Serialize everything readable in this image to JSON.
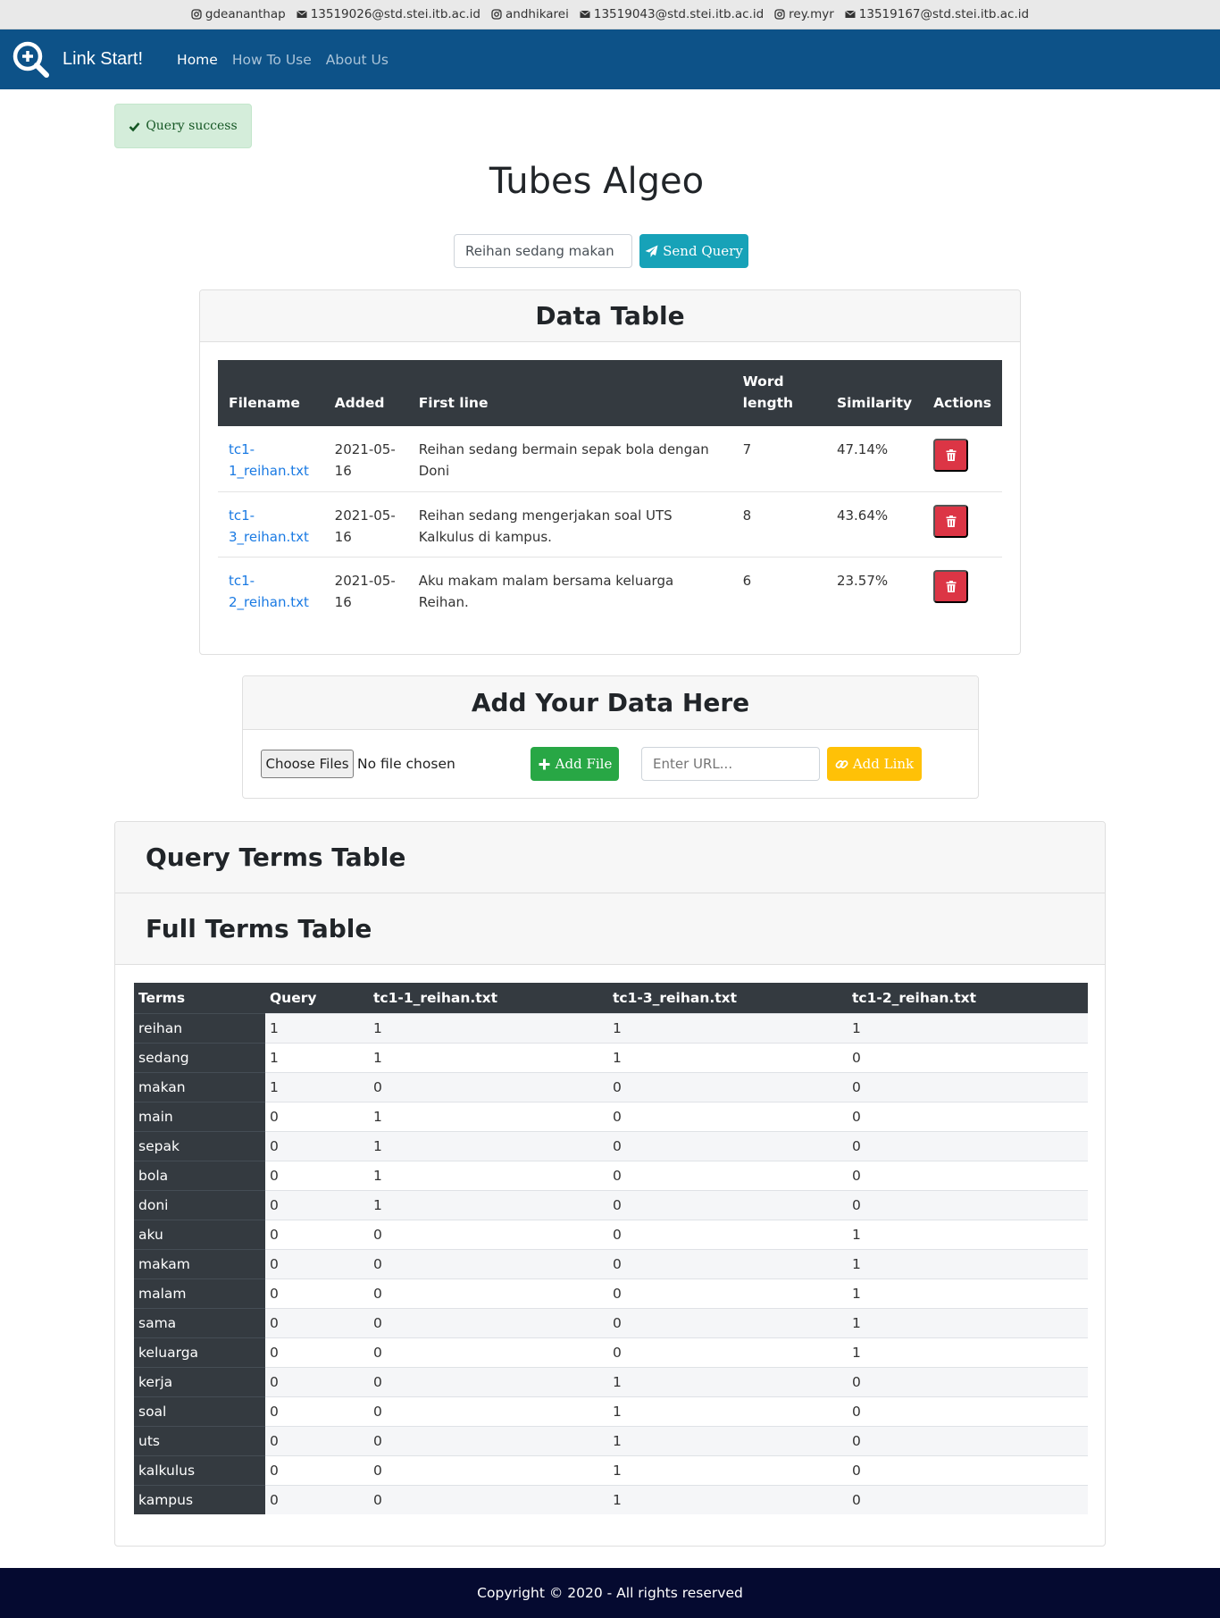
{
  "topbar": {
    "contacts": [
      {
        "icon": "instagram-icon",
        "text": "gdeananthap"
      },
      {
        "icon": "envelope-icon",
        "text": "13519026@std.stei.itb.ac.id"
      },
      {
        "icon": "instagram-icon",
        "text": "andhikarei"
      },
      {
        "icon": "envelope-icon",
        "text": "13519043@std.stei.itb.ac.id"
      },
      {
        "icon": "instagram-icon",
        "text": "rey.myr"
      },
      {
        "icon": "envelope-icon",
        "text": "13519167@std.stei.itb.ac.id"
      }
    ]
  },
  "navbar": {
    "brand": "Link Start!",
    "links": [
      "Home",
      "How To Use",
      "About Us"
    ],
    "active": "Home",
    "color": "#0d5288"
  },
  "alert": {
    "text": "Query success",
    "icon": "check-icon"
  },
  "title": "Tubes Algeo",
  "query": {
    "value": "Reihan sedang makan",
    "button": "Send Query",
    "icon": "paper-plane-icon"
  },
  "data_table": {
    "title": "Data Table",
    "headers": [
      "Filename",
      "Added",
      "First line",
      "Word length",
      "Similarity",
      "Actions"
    ],
    "rows": [
      {
        "filename": "tc1-1_reihan.txt",
        "added": "2021-05-16",
        "first_line": "Reihan sedang bermain sepak bola dengan Doni",
        "word_length": "7",
        "similarity": "47.14%"
      },
      {
        "filename": "tc1-3_reihan.txt",
        "added": "2021-05-16",
        "first_line": "Reihan sedang mengerjakan soal UTS Kalkulus di kampus.",
        "word_length": "8",
        "similarity": "43.64%"
      },
      {
        "filename": "tc1-2_reihan.txt",
        "added": "2021-05-16",
        "first_line": "Aku makam malam bersama keluarga Reihan.",
        "word_length": "6",
        "similarity": "23.57%"
      }
    ]
  },
  "add_data": {
    "title": "Add Your Data Here",
    "choose_files": "Choose Files",
    "no_file": "No file chosen",
    "add_file": "Add File",
    "url_placeholder": "Enter URL...",
    "add_link": "Add Link"
  },
  "query_terms_title": "Query Terms Table",
  "full_terms": {
    "title": "Full Terms Table",
    "headers": [
      "Terms",
      "Query",
      "tc1-1_reihan.txt",
      "tc1-3_reihan.txt",
      "tc1-2_reihan.txt"
    ],
    "rows": [
      [
        "reihan",
        "1",
        "1",
        "1",
        "1"
      ],
      [
        "sedang",
        "1",
        "1",
        "1",
        "0"
      ],
      [
        "makan",
        "1",
        "0",
        "0",
        "0"
      ],
      [
        "main",
        "0",
        "1",
        "0",
        "0"
      ],
      [
        "sepak",
        "0",
        "1",
        "0",
        "0"
      ],
      [
        "bola",
        "0",
        "1",
        "0",
        "0"
      ],
      [
        "doni",
        "0",
        "1",
        "0",
        "0"
      ],
      [
        "aku",
        "0",
        "0",
        "0",
        "1"
      ],
      [
        "makam",
        "0",
        "0",
        "0",
        "1"
      ],
      [
        "malam",
        "0",
        "0",
        "0",
        "1"
      ],
      [
        "sama",
        "0",
        "0",
        "0",
        "1"
      ],
      [
        "keluarga",
        "0",
        "0",
        "0",
        "1"
      ],
      [
        "kerja",
        "0",
        "0",
        "1",
        "0"
      ],
      [
        "soal",
        "0",
        "0",
        "1",
        "0"
      ],
      [
        "uts",
        "0",
        "0",
        "1",
        "0"
      ],
      [
        "kalkulus",
        "0",
        "0",
        "1",
        "0"
      ],
      [
        "kampus",
        "0",
        "0",
        "1",
        "0"
      ]
    ]
  },
  "footer": "Copyright © 2020 - All rights reserved"
}
